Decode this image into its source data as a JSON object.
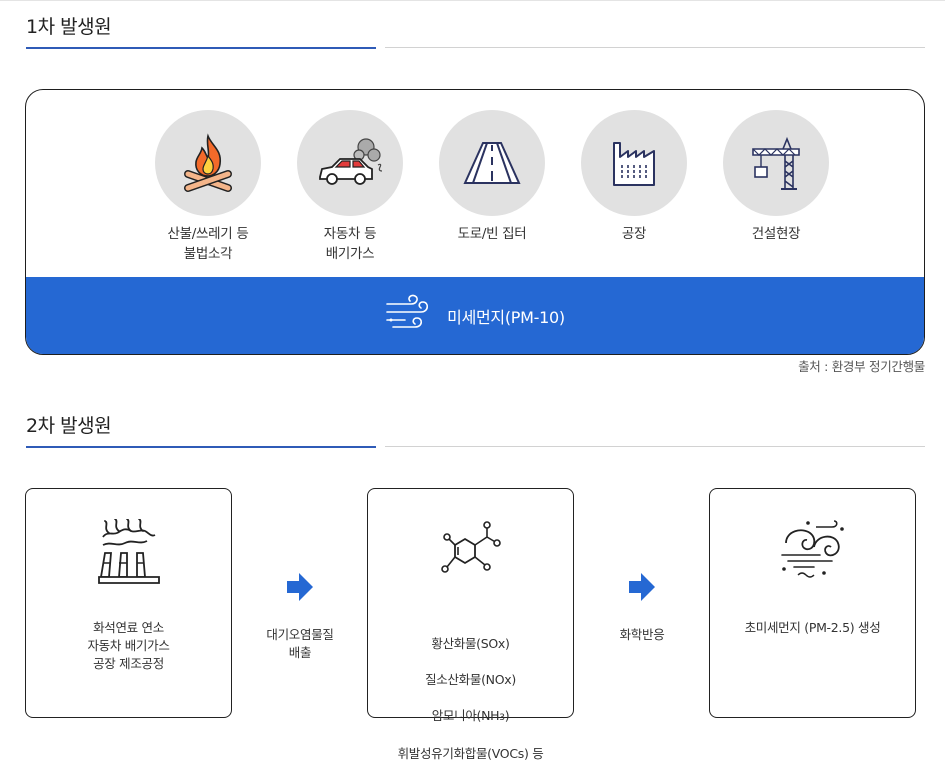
{
  "section1": {
    "title": "1차 발생원",
    "sources": [
      {
        "label": "산불/쓰레기 등\n불법소각",
        "icon": "campfire-icon"
      },
      {
        "label": "자동차 등\n배기가스",
        "icon": "car-exhaust-icon"
      },
      {
        "label": "도로/빈 집터",
        "icon": "road-icon"
      },
      {
        "label": "공장",
        "icon": "factory-icon"
      },
      {
        "label": "건설현장",
        "icon": "construction-crane-icon"
      }
    ],
    "result": {
      "label": "미세먼지(PM-10)",
      "icon": "wind-icon"
    },
    "source_note": "출처 : 환경부 정기간행물"
  },
  "section2": {
    "title": "2차 발생원",
    "box1": {
      "label": "화석연료 연소\n자동차 배기가스\n공장 제조공정",
      "icon": "smokestack-icon"
    },
    "arrow1": {
      "label": "대기오염물질\n배출",
      "icon": "arrow-right-icon"
    },
    "box2": {
      "line1": "황산화물(SOx)",
      "line2": "질소산화물(NOx)",
      "line3_prefix": "암모니아(NH",
      "line3_sub": "3",
      "line3_suffix": ")",
      "line4": "휘발성유기화합물(VOCs) 등",
      "icon": "molecule-icon"
    },
    "arrow2": {
      "label": "화학반응",
      "icon": "arrow-right-icon"
    },
    "box3": {
      "label": "초미세먼지 (PM-2.5) 생성",
      "icon": "dust-swirl-icon"
    }
  },
  "colors": {
    "accent_blue": "#2568d3",
    "rule_blue": "#2f5bb7",
    "icon_circle": "#e1e1e1",
    "arrow": "#2568d3"
  }
}
